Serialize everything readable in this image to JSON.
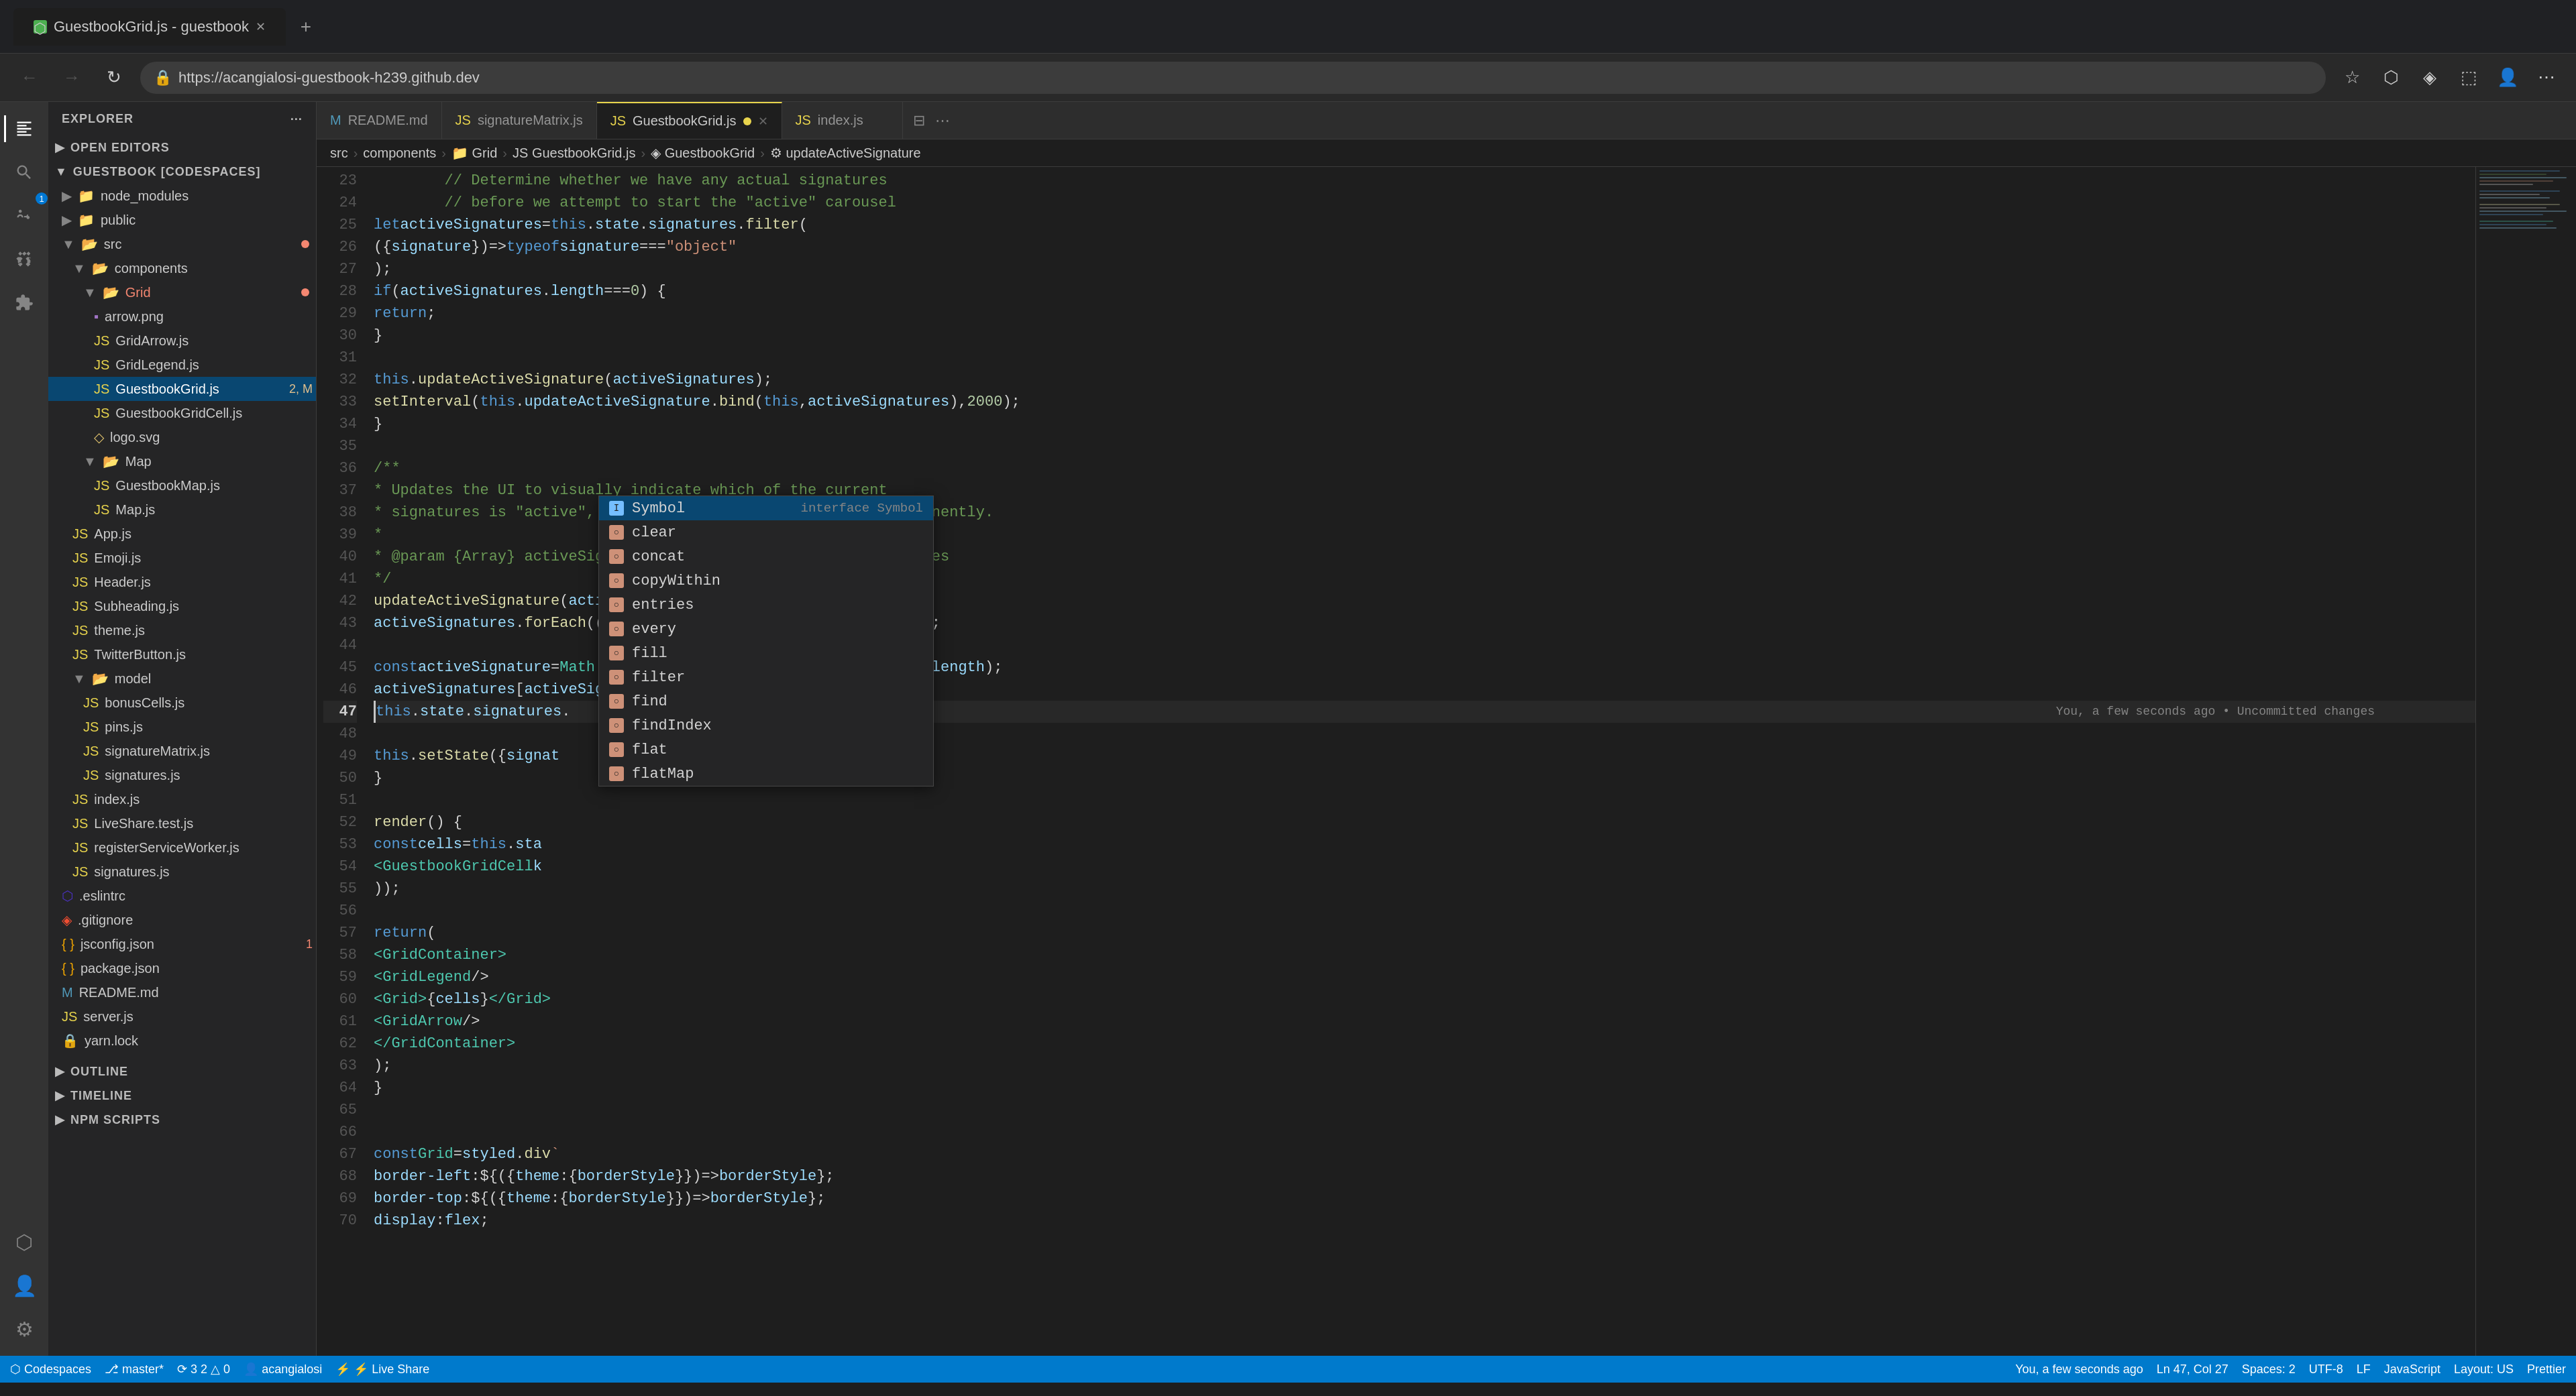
{
  "browser": {
    "tab_title": "GuestbookGrid.js - guestbook",
    "url": "https://acangialosi-guestbook-h239.github.dev",
    "favicon": "🟢"
  },
  "editor_tabs": [
    {
      "label": "README.md",
      "icon": "md",
      "active": false,
      "modified": false
    },
    {
      "label": "signatureMatrix.js",
      "icon": "js",
      "active": false,
      "modified": false
    },
    {
      "label": "GuestbookGrid.js",
      "icon": "js",
      "active": true,
      "modified": true
    },
    {
      "label": "index.js",
      "icon": "js",
      "active": false,
      "modified": false
    }
  ],
  "breadcrumb": {
    "items": [
      "src",
      "components",
      "Grid",
      "GuestbookGrid.js",
      "GuestbookGrid",
      "updateActiveSignature"
    ]
  },
  "sidebar": {
    "title": "EXPLORER",
    "sections": {
      "open_editors": "OPEN EDITORS",
      "project": "GUESTBOOK [CODESPACES]"
    },
    "tree": [
      {
        "type": "folder",
        "name": "node_modules",
        "indent": 1,
        "open": false
      },
      {
        "type": "folder",
        "name": "public",
        "indent": 1,
        "open": false
      },
      {
        "type": "folder",
        "name": "src",
        "indent": 1,
        "open": true
      },
      {
        "type": "folder",
        "name": "components",
        "indent": 2,
        "open": true
      },
      {
        "type": "folder",
        "name": "Grid",
        "indent": 3,
        "open": true,
        "dot": true
      },
      {
        "type": "file",
        "name": "arrow.png",
        "ext": "png",
        "indent": 4
      },
      {
        "type": "file",
        "name": "GridArrow.js",
        "ext": "js",
        "indent": 4
      },
      {
        "type": "file",
        "name": "GridLegend.js",
        "ext": "js",
        "indent": 4
      },
      {
        "type": "file",
        "name": "GuestbookGrid.js",
        "ext": "js",
        "indent": 4,
        "active": true,
        "modified": "2, M"
      },
      {
        "type": "file",
        "name": "GuestbookGridCell.js",
        "ext": "js",
        "indent": 4
      },
      {
        "type": "file",
        "name": "logo.svg",
        "ext": "svg",
        "indent": 4
      },
      {
        "type": "folder",
        "name": "Map",
        "indent": 3,
        "open": true
      },
      {
        "type": "file",
        "name": "GuestbookMap.js",
        "ext": "js",
        "indent": 4
      },
      {
        "type": "file",
        "name": "Map.js",
        "ext": "js",
        "indent": 4
      },
      {
        "type": "file",
        "name": "App.js",
        "ext": "js",
        "indent": 2
      },
      {
        "type": "file",
        "name": "Emoji.js",
        "ext": "js",
        "indent": 2
      },
      {
        "type": "file",
        "name": "Header.js",
        "ext": "js",
        "indent": 2
      },
      {
        "type": "file",
        "name": "Subheading.js",
        "ext": "js",
        "indent": 2
      },
      {
        "type": "file",
        "name": "theme.js",
        "ext": "js",
        "indent": 2
      },
      {
        "type": "file",
        "name": "TwitterButton.js",
        "ext": "js",
        "indent": 2
      },
      {
        "type": "folder",
        "name": "model",
        "indent": 2,
        "open": true
      },
      {
        "type": "file",
        "name": "bonusCells.js",
        "ext": "js",
        "indent": 3
      },
      {
        "type": "file",
        "name": "pins.js",
        "ext": "js",
        "indent": 3
      },
      {
        "type": "file",
        "name": "signatureMatrix.js",
        "ext": "js",
        "indent": 3
      },
      {
        "type": "file",
        "name": "signatures.js",
        "ext": "js",
        "indent": 3
      },
      {
        "type": "file",
        "name": "index.js",
        "ext": "js",
        "indent": 2
      },
      {
        "type": "file",
        "name": "LiveShare.test.js",
        "ext": "js",
        "indent": 2
      },
      {
        "type": "file",
        "name": "registerServiceWorker.js",
        "ext": "js",
        "indent": 2
      },
      {
        "type": "file",
        "name": "signatures.js",
        "ext": "js",
        "indent": 2
      },
      {
        "type": "file",
        "name": ".eslintrc",
        "ext": "eslint",
        "indent": 1
      },
      {
        "type": "file",
        "name": ".gitignore",
        "ext": "git",
        "indent": 1
      },
      {
        "type": "file",
        "name": "jsconfig.json",
        "ext": "json",
        "indent": 1,
        "modified": "1"
      },
      {
        "type": "file",
        "name": "package.json",
        "ext": "json",
        "indent": 1
      },
      {
        "type": "file",
        "name": "README.md",
        "ext": "md",
        "indent": 1
      },
      {
        "type": "file",
        "name": "server.js",
        "ext": "js",
        "indent": 1
      },
      {
        "type": "file",
        "name": "yarn.lock",
        "ext": "lock",
        "indent": 1
      }
    ]
  },
  "outline": "OUTLINE",
  "timeline": "TIMELINE",
  "npm_scripts": "NPM SCRIPTS",
  "code_lines": [
    {
      "num": 23,
      "content": "// Determine whether we have any actual signatures"
    },
    {
      "num": 24,
      "content": "// before we attempt to start the \"active\" carousel"
    },
    {
      "num": 25,
      "content": "let activeSignatures = this.state.signatures.filter("
    },
    {
      "num": 26,
      "content": "    ({ signature }) => typeof signature === \"object\""
    },
    {
      "num": 27,
      "content": ");"
    },
    {
      "num": 28,
      "content": "if (activeSignatures.length === 0) {"
    },
    {
      "num": 29,
      "content": "    return;"
    },
    {
      "num": 30,
      "content": "}"
    },
    {
      "num": 31,
      "content": ""
    },
    {
      "num": 32,
      "content": "this.updateActiveSignature(activeSignatures);"
    },
    {
      "num": 33,
      "content": "setInterval(this.updateActiveSignature.bind(this, activeSignatures), 2000);"
    },
    {
      "num": 34,
      "content": "}"
    },
    {
      "num": 35,
      "content": ""
    },
    {
      "num": 36,
      "content": "/**"
    },
    {
      "num": 37,
      "content": " * Updates the UI to visually indicate which of the current"
    },
    {
      "num": 38,
      "content": " * signatures is \"active\", and therefore, highlighted more prominently."
    },
    {
      "num": 39,
      "content": " *"
    },
    {
      "num": 40,
      "content": " * @param {Array} activeSignatures - An array of active signatures"
    },
    {
      "num": 41,
      "content": " */"
    },
    {
      "num": 42,
      "content": "updateActiveSignature(activeSignatures) {"
    },
    {
      "num": 43,
      "content": "    activeSignatures.forEach((signature) => delete signature.isActive);"
    },
    {
      "num": 44,
      "content": ""
    },
    {
      "num": 45,
      "content": "    const activeSignature = Math.floor(Math.random() * activeSignatures.length);"
    },
    {
      "num": 46,
      "content": "    activeSignatures[activeSignature].isActive = true;"
    },
    {
      "num": 47,
      "content": "    this.state.signatures."
    },
    {
      "num": 48,
      "content": ""
    },
    {
      "num": 49,
      "content": "    this.setState({ signat"
    },
    {
      "num": 50,
      "content": "}"
    },
    {
      "num": 51,
      "content": ""
    },
    {
      "num": 52,
      "content": "render() {"
    },
    {
      "num": 53,
      "content": "    const cells = this.sta"
    },
    {
      "num": 54,
      "content": "        <GuestbookGridCell k"
    },
    {
      "num": 55,
      "content": "    ));"
    },
    {
      "num": 56,
      "content": ""
    },
    {
      "num": 57,
      "content": "    return ("
    },
    {
      "num": 58,
      "content": "        <GridContainer>"
    },
    {
      "num": 59,
      "content": "            <GridLegend />"
    },
    {
      "num": 60,
      "content": "            <Grid>{cells}</Grid>"
    },
    {
      "num": 61,
      "content": "            <GridArrow />"
    },
    {
      "num": 62,
      "content": "        </GridContainer>"
    },
    {
      "num": 63,
      "content": "    );"
    },
    {
      "num": 64,
      "content": "}"
    },
    {
      "num": 65,
      "content": ""
    },
    {
      "num": 66,
      "content": ""
    },
    {
      "num": 67,
      "content": "const Grid = styled.div`"
    },
    {
      "num": 68,
      "content": "border-left: ${({ theme: { borderStyle } }) => borderStyle};"
    },
    {
      "num": 69,
      "content": "border-top: ${({ theme: { borderStyle } }) => borderStyle};"
    },
    {
      "num": 70,
      "content": "display: flex;"
    }
  ],
  "autocomplete": {
    "items": [
      {
        "label": "Symbol",
        "type": "interface Symbol",
        "selected": true
      },
      {
        "label": "clear",
        "type": "",
        "icon": "circle"
      },
      {
        "label": "concat",
        "type": "",
        "icon": "circle"
      },
      {
        "label": "copyWithin",
        "type": "",
        "icon": "circle"
      },
      {
        "label": "entries",
        "type": "",
        "icon": "circle"
      },
      {
        "label": "every",
        "type": "",
        "icon": "circle"
      },
      {
        "label": "fill",
        "type": "",
        "icon": "circle"
      },
      {
        "label": "filter",
        "type": "",
        "icon": "circle"
      },
      {
        "label": "find",
        "type": "",
        "icon": "circle"
      },
      {
        "label": "findIndex",
        "type": "",
        "icon": "circle"
      },
      {
        "label": "flat",
        "type": "",
        "icon": "circle"
      },
      {
        "label": "flatMap",
        "type": "",
        "icon": "circle"
      }
    ]
  },
  "git_tooltip": "You, a few seconds ago • Uncommitted changes",
  "status_bar": {
    "left": [
      {
        "icon": "codespace",
        "label": "Codespaces"
      },
      {
        "icon": "git-branch",
        "label": "master*"
      },
      {
        "icon": "sync",
        "label": "3 2 △ 0"
      },
      {
        "icon": "user",
        "label": "acangialosi"
      }
    ],
    "right": [
      {
        "label": "You, a few seconds ago"
      },
      {
        "label": "Ln 47, Col 27"
      },
      {
        "label": "Spaces: 2"
      },
      {
        "label": "UTF-8"
      },
      {
        "label": "LF"
      },
      {
        "label": "JavaScript"
      },
      {
        "label": "Layout: US"
      },
      {
        "label": "Prettier"
      }
    ],
    "liveshare": "⚡ Live Share"
  }
}
